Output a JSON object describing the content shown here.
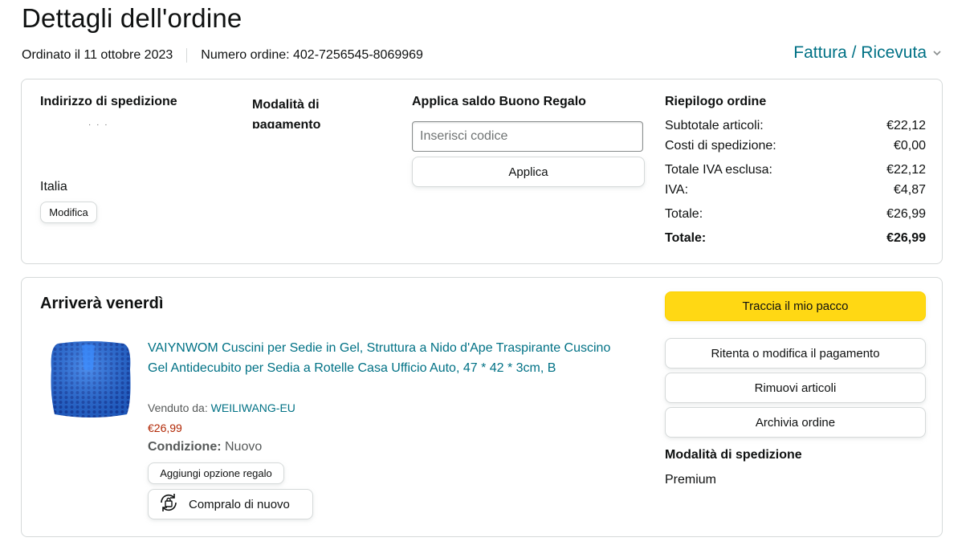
{
  "header": {
    "title": "Dettagli dell'ordine",
    "order_date": "Ordinato il 11 ottobre 2023",
    "order_number": "Numero ordine: 402-7256545-8069969",
    "invoice_link": "Fattura / Ricevuta"
  },
  "address": {
    "heading": "Indirizzo di spedizione",
    "redacted_line": "·   ·  ·",
    "country": "Italia",
    "edit_label": "Modifica"
  },
  "payment": {
    "heading": "Modalità di pagamento"
  },
  "gift_card": {
    "heading": "Applica saldo Buono Regalo",
    "placeholder": "Inserisci codice",
    "apply_label": "Applica"
  },
  "summary": {
    "heading": "Riepilogo ordine",
    "rows": [
      {
        "label": "Subtotale articoli:",
        "value": "€22,12"
      },
      {
        "label": "Costi di spedizione:",
        "value": "€0,00"
      },
      {
        "label": "Totale IVA esclusa:",
        "value": "€22,12"
      },
      {
        "label": "IVA:",
        "value": "€4,87"
      },
      {
        "label": "Totale:",
        "value": "€26,99"
      },
      {
        "label": "Totale:",
        "value": "€26,99"
      }
    ]
  },
  "shipment": {
    "arrival": "Arriverà venerdì",
    "product": {
      "title": "VAIYNWOM Cuscini per Sedie in Gel, Struttura a Nido d'Ape Traspirante Cuscino Gel Antidecubito per Sedia a Rotelle Casa Ufficio Auto, 47 * 42 * 3cm, B",
      "sold_by_label": "Venduto da:",
      "seller": "WEILIWANG-EU",
      "price": "€26,99",
      "condition_label": "Condizione:",
      "condition_value": "Nuovo",
      "gift_option_label": "Aggiungi opzione regalo",
      "buy_again_label": "Compralo di nuovo"
    },
    "actions": {
      "track": "Traccia il mio pacco",
      "retry_payment": "Ritenta o modifica il pagamento",
      "remove_items": "Rimuovi articoli",
      "archive_order": "Archivia ordine"
    },
    "shipping_method_heading": "Modalità di spedizione",
    "shipping_method": "Premium"
  },
  "colors": {
    "link": "#007185",
    "price": "#b12704",
    "primary_button": "#ffd814",
    "border": "#d5d9d9"
  },
  "icons": [
    "chevron-down-icon",
    "buy-again-icon",
    "product-thumbnail"
  ]
}
